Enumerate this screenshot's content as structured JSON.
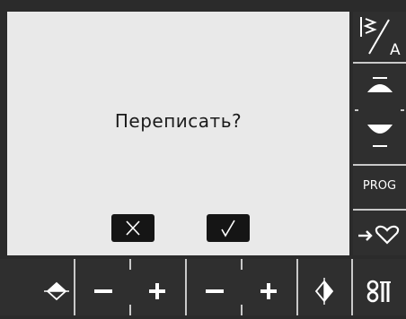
{
  "dialog": {
    "message": "Переписать?",
    "cancel_symbol": "✕",
    "confirm_symbol": "√"
  },
  "sidebar": {
    "prog_label": "PROG"
  },
  "colors": {
    "screen_bg": "#e9e9e9",
    "frame_bg": "#2b2b2b",
    "button_bg": "#151515",
    "separator": "#c9c9c9",
    "icon": "#ffffff"
  }
}
